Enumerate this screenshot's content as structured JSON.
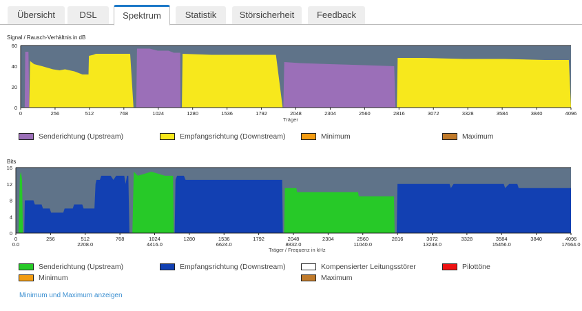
{
  "tabs": [
    {
      "label": "Übersicht"
    },
    {
      "label": "DSL"
    },
    {
      "label": "Spektrum",
      "active": true
    },
    {
      "label": "Statistik"
    },
    {
      "label": "Störsicherheit"
    },
    {
      "label": "Feedback"
    }
  ],
  "chart_data": [
    {
      "type": "area",
      "ylabel": "Signal / Rausch-Verhältnis in dB",
      "xlabel": "Träger",
      "xlim": [
        0,
        4096
      ],
      "ylim": [
        0,
        60
      ],
      "yticks": [
        "0",
        "20",
        "40",
        "60"
      ],
      "xticks": [
        "0",
        "256",
        "512",
        "768",
        "1024",
        "1280",
        "1536",
        "1792",
        "2048",
        "2304",
        "2560",
        "2816",
        "3072",
        "3328",
        "3584",
        "3840",
        "4096"
      ],
      "background": "#5f7389",
      "series": [
        {
          "name": "Senderichtung (Upstream)",
          "color": "#9b6fb8",
          "segments": [
            [
              [
                30,
                0
              ],
              [
                34,
                54
              ],
              [
                58,
                54
              ],
              [
                64,
                0
              ]
            ],
            [
              [
                860,
                0
              ],
              [
                866,
                57
              ],
              [
                960,
                57
              ],
              [
                1020,
                55
              ],
              [
                1100,
                55
              ],
              [
                1140,
                53
              ],
              [
                1188,
                53
              ],
              [
                1190,
                0
              ]
            ],
            [
              [
                1955,
                0
              ],
              [
                1962,
                44
              ],
              [
                2080,
                43
              ],
              [
                2300,
                42
              ],
              [
                2560,
                41
              ],
              [
                2780,
                40
              ],
              [
                2790,
                0
              ]
            ]
          ]
        },
        {
          "name": "Empfangsrichtung (Downstream)",
          "color": "#f7e81c",
          "segments": [
            [
              [
                64,
                0
              ],
              [
                70,
                45
              ],
              [
                100,
                42
              ],
              [
                160,
                40
              ],
              [
                240,
                37
              ],
              [
                290,
                36
              ],
              [
                330,
                37
              ],
              [
                400,
                35
              ],
              [
                460,
                32
              ],
              [
                505,
                32
              ],
              [
                508,
                50
              ],
              [
                540,
                51
              ],
              [
                560,
                52
              ],
              [
                700,
                52
              ],
              [
                815,
                52
              ],
              [
                840,
                0
              ]
            ],
            [
              [
                1200,
                0
              ],
              [
                1205,
                52
              ],
              [
                1420,
                51
              ],
              [
                1700,
                51
              ],
              [
                1900,
                51
              ],
              [
                1950,
                0
              ]
            ],
            [
              [
                2800,
                0
              ],
              [
                2806,
                48
              ],
              [
                3000,
                48
              ],
              [
                3300,
                47
              ],
              [
                3600,
                47
              ],
              [
                3900,
                46
              ],
              [
                4080,
                46
              ],
              [
                4096,
                0
              ]
            ]
          ]
        },
        {
          "name": "Minimum",
          "color": "#f39c12",
          "segments": []
        },
        {
          "name": "Maximum",
          "color": "#c07a2a",
          "segments": []
        }
      ]
    },
    {
      "type": "area",
      "ylabel": "Bits",
      "xlabel": "Träger / Frequenz in kHz",
      "xlim": [
        0,
        4096
      ],
      "ylim": [
        0,
        16
      ],
      "yticks": [
        "0",
        "4",
        "8",
        "12",
        "16"
      ],
      "xticks": [
        "0",
        "256",
        "512",
        "768",
        "1024",
        "1280",
        "1536",
        "1792",
        "2048",
        "2304",
        "2560",
        "2816",
        "3072",
        "3328",
        "3584",
        "3840",
        "4096"
      ],
      "xticks2": [
        "0.0",
        "2208.0",
        "4416.0",
        "6624.0",
        "8832.0",
        "11040.0",
        "13248.0",
        "15456.0",
        "17664.0"
      ],
      "background": "#5f7389",
      "series": [
        {
          "name": "Senderichtung (Upstream)",
          "color": "#27c928",
          "segments": [
            [
              [
                20,
                0
              ],
              [
                30,
                14
              ],
              [
                38,
                15
              ],
              [
                46,
                13
              ],
              [
                52,
                0
              ]
            ],
            [
              [
                860,
                0
              ],
              [
                870,
                15
              ],
              [
                900,
                14
              ],
              [
                1000,
                15
              ],
              [
                1100,
                14
              ],
              [
                1160,
                14
              ],
              [
                1165,
                0
              ]
            ],
            [
              [
                1980,
                0
              ],
              [
                1985,
                11
              ],
              [
                2070,
                11
              ],
              [
                2075,
                10
              ],
              [
                2525,
                10
              ],
              [
                2530,
                9
              ],
              [
                2790,
                9
              ],
              [
                2795,
                0
              ]
            ]
          ]
        },
        {
          "name": "Empfangsrichtung (Downstream)",
          "color": "#1240b2",
          "segments": [
            [
              [
                62,
                0
              ],
              [
                66,
                8
              ],
              [
                130,
                8
              ],
              [
                140,
                7
              ],
              [
                190,
                7
              ],
              [
                200,
                6
              ],
              [
                250,
                6
              ],
              [
                260,
                5
              ],
              [
                350,
                5
              ],
              [
                360,
                6
              ],
              [
                420,
                6
              ],
              [
                430,
                7
              ],
              [
                490,
                7
              ],
              [
                500,
                6
              ],
              [
                580,
                6
              ],
              [
                588,
                12
              ],
              [
                595,
                13
              ],
              [
                620,
                13
              ],
              [
                630,
                14
              ],
              [
                700,
                14
              ],
              [
                720,
                13
              ],
              [
                740,
                14
              ],
              [
                800,
                14
              ],
              [
                810,
                12
              ],
              [
                820,
                14
              ],
              [
                830,
                14
              ],
              [
                838,
                0
              ]
            ],
            [
              [
                1172,
                0
              ],
              [
                1178,
                13
              ],
              [
                1190,
                14
              ],
              [
                1240,
                14
              ],
              [
                1252,
                13
              ],
              [
                1965,
                13
              ],
              [
                1970,
                0
              ]
            ],
            [
              [
                2810,
                0
              ],
              [
                2816,
                12
              ],
              [
                3200,
                12
              ],
              [
                3210,
                11
              ],
              [
                3230,
                12
              ],
              [
                3600,
                12
              ],
              [
                3610,
                11
              ],
              [
                3640,
                12
              ],
              [
                3700,
                12
              ],
              [
                3710,
                11
              ],
              [
                4096,
                11
              ],
              [
                4096,
                0
              ]
            ]
          ]
        },
        {
          "name": "Kompensierter Leitungsstörer",
          "color": "#ffffff",
          "segments": []
        },
        {
          "name": "Pilottöne",
          "color": "#ee1111",
          "segments": []
        },
        {
          "name": "Minimum",
          "color": "#f39c12",
          "segments": []
        },
        {
          "name": "Maximum",
          "color": "#c07a2a",
          "segments": []
        }
      ]
    }
  ],
  "link": "Minimum und Maximum anzeigen"
}
